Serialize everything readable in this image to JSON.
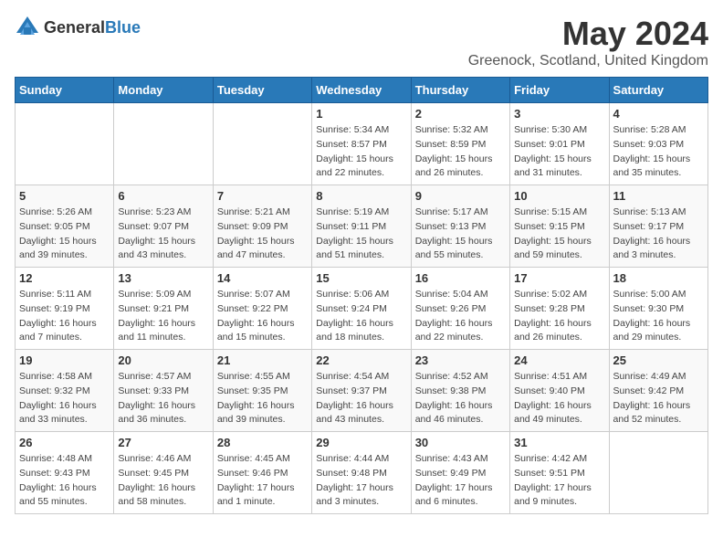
{
  "logo": {
    "general": "General",
    "blue": "Blue"
  },
  "title": "May 2024",
  "subtitle": "Greenock, Scotland, United Kingdom",
  "days_of_week": [
    "Sunday",
    "Monday",
    "Tuesday",
    "Wednesday",
    "Thursday",
    "Friday",
    "Saturday"
  ],
  "weeks": [
    [
      {
        "day": "",
        "info": ""
      },
      {
        "day": "",
        "info": ""
      },
      {
        "day": "",
        "info": ""
      },
      {
        "day": "1",
        "info": "Sunrise: 5:34 AM\nSunset: 8:57 PM\nDaylight: 15 hours\nand 22 minutes."
      },
      {
        "day": "2",
        "info": "Sunrise: 5:32 AM\nSunset: 8:59 PM\nDaylight: 15 hours\nand 26 minutes."
      },
      {
        "day": "3",
        "info": "Sunrise: 5:30 AM\nSunset: 9:01 PM\nDaylight: 15 hours\nand 31 minutes."
      },
      {
        "day": "4",
        "info": "Sunrise: 5:28 AM\nSunset: 9:03 PM\nDaylight: 15 hours\nand 35 minutes."
      }
    ],
    [
      {
        "day": "5",
        "info": "Sunrise: 5:26 AM\nSunset: 9:05 PM\nDaylight: 15 hours\nand 39 minutes."
      },
      {
        "day": "6",
        "info": "Sunrise: 5:23 AM\nSunset: 9:07 PM\nDaylight: 15 hours\nand 43 minutes."
      },
      {
        "day": "7",
        "info": "Sunrise: 5:21 AM\nSunset: 9:09 PM\nDaylight: 15 hours\nand 47 minutes."
      },
      {
        "day": "8",
        "info": "Sunrise: 5:19 AM\nSunset: 9:11 PM\nDaylight: 15 hours\nand 51 minutes."
      },
      {
        "day": "9",
        "info": "Sunrise: 5:17 AM\nSunset: 9:13 PM\nDaylight: 15 hours\nand 55 minutes."
      },
      {
        "day": "10",
        "info": "Sunrise: 5:15 AM\nSunset: 9:15 PM\nDaylight: 15 hours\nand 59 minutes."
      },
      {
        "day": "11",
        "info": "Sunrise: 5:13 AM\nSunset: 9:17 PM\nDaylight: 16 hours\nand 3 minutes."
      }
    ],
    [
      {
        "day": "12",
        "info": "Sunrise: 5:11 AM\nSunset: 9:19 PM\nDaylight: 16 hours\nand 7 minutes."
      },
      {
        "day": "13",
        "info": "Sunrise: 5:09 AM\nSunset: 9:21 PM\nDaylight: 16 hours\nand 11 minutes."
      },
      {
        "day": "14",
        "info": "Sunrise: 5:07 AM\nSunset: 9:22 PM\nDaylight: 16 hours\nand 15 minutes."
      },
      {
        "day": "15",
        "info": "Sunrise: 5:06 AM\nSunset: 9:24 PM\nDaylight: 16 hours\nand 18 minutes."
      },
      {
        "day": "16",
        "info": "Sunrise: 5:04 AM\nSunset: 9:26 PM\nDaylight: 16 hours\nand 22 minutes."
      },
      {
        "day": "17",
        "info": "Sunrise: 5:02 AM\nSunset: 9:28 PM\nDaylight: 16 hours\nand 26 minutes."
      },
      {
        "day": "18",
        "info": "Sunrise: 5:00 AM\nSunset: 9:30 PM\nDaylight: 16 hours\nand 29 minutes."
      }
    ],
    [
      {
        "day": "19",
        "info": "Sunrise: 4:58 AM\nSunset: 9:32 PM\nDaylight: 16 hours\nand 33 minutes."
      },
      {
        "day": "20",
        "info": "Sunrise: 4:57 AM\nSunset: 9:33 PM\nDaylight: 16 hours\nand 36 minutes."
      },
      {
        "day": "21",
        "info": "Sunrise: 4:55 AM\nSunset: 9:35 PM\nDaylight: 16 hours\nand 39 minutes."
      },
      {
        "day": "22",
        "info": "Sunrise: 4:54 AM\nSunset: 9:37 PM\nDaylight: 16 hours\nand 43 minutes."
      },
      {
        "day": "23",
        "info": "Sunrise: 4:52 AM\nSunset: 9:38 PM\nDaylight: 16 hours\nand 46 minutes."
      },
      {
        "day": "24",
        "info": "Sunrise: 4:51 AM\nSunset: 9:40 PM\nDaylight: 16 hours\nand 49 minutes."
      },
      {
        "day": "25",
        "info": "Sunrise: 4:49 AM\nSunset: 9:42 PM\nDaylight: 16 hours\nand 52 minutes."
      }
    ],
    [
      {
        "day": "26",
        "info": "Sunrise: 4:48 AM\nSunset: 9:43 PM\nDaylight: 16 hours\nand 55 minutes."
      },
      {
        "day": "27",
        "info": "Sunrise: 4:46 AM\nSunset: 9:45 PM\nDaylight: 16 hours\nand 58 minutes."
      },
      {
        "day": "28",
        "info": "Sunrise: 4:45 AM\nSunset: 9:46 PM\nDaylight: 17 hours\nand 1 minute."
      },
      {
        "day": "29",
        "info": "Sunrise: 4:44 AM\nSunset: 9:48 PM\nDaylight: 17 hours\nand 3 minutes."
      },
      {
        "day": "30",
        "info": "Sunrise: 4:43 AM\nSunset: 9:49 PM\nDaylight: 17 hours\nand 6 minutes."
      },
      {
        "day": "31",
        "info": "Sunrise: 4:42 AM\nSunset: 9:51 PM\nDaylight: 17 hours\nand 9 minutes."
      },
      {
        "day": "",
        "info": ""
      }
    ]
  ]
}
